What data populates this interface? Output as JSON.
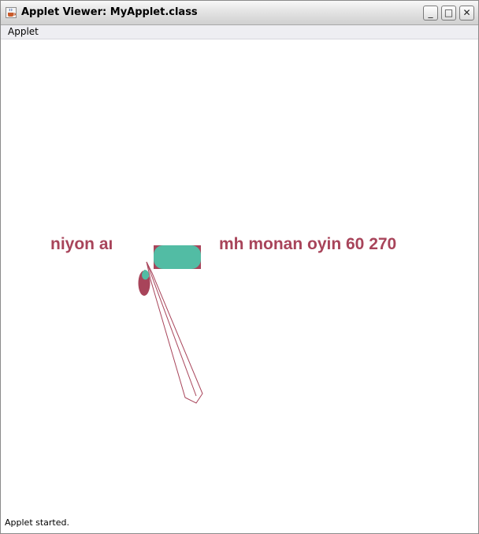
{
  "window": {
    "title": "Applet Viewer: MyApplet.class",
    "icon": "java-cup-icon",
    "buttons": {
      "minimize_glyph": "_",
      "maximize_glyph": "□",
      "close_glyph": "✕"
    }
  },
  "menubar": {
    "items": [
      {
        "label": "Applet"
      }
    ]
  },
  "applet": {
    "text_left": "niyon aı",
    "text_right": "mh monan oyin 60 270",
    "colors": {
      "text": "#a8445a",
      "fill_teal": "#52bca4",
      "fill_maroon": "#a8445a",
      "background": "#ffffff"
    }
  },
  "status": {
    "text": "Applet started."
  }
}
